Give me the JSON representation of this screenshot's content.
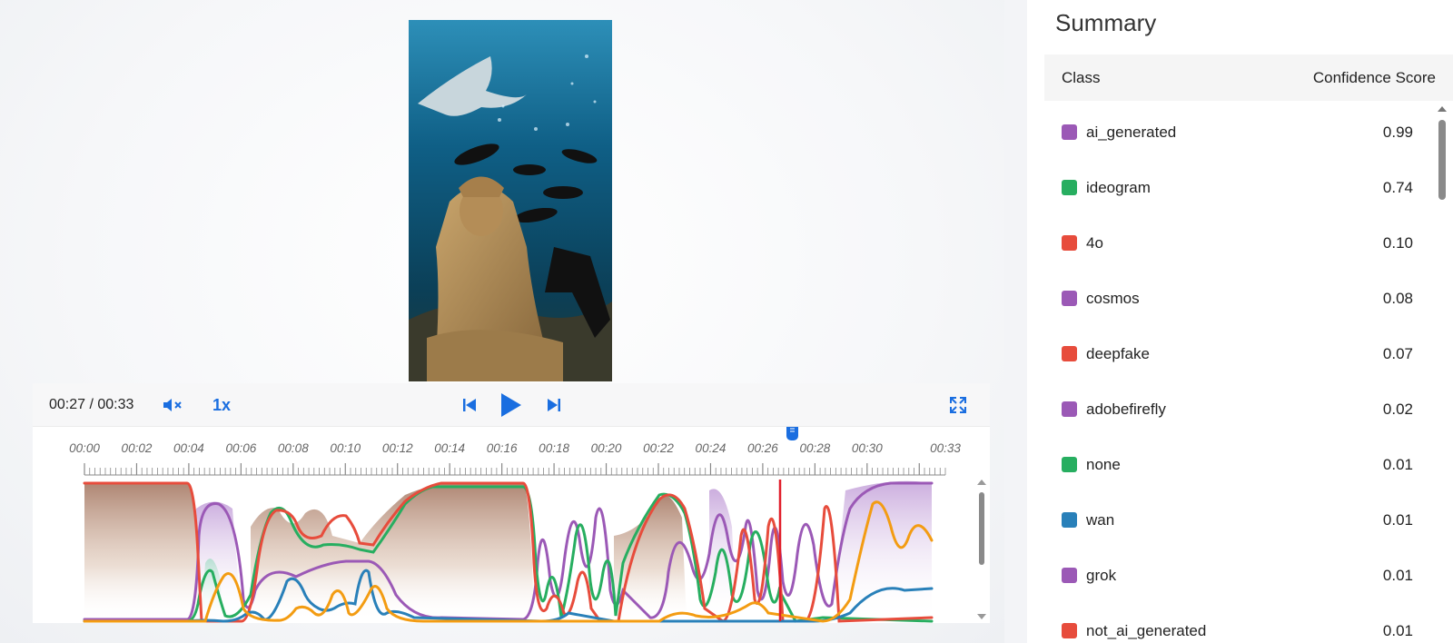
{
  "player": {
    "time": "00:27 / 00:33",
    "speed": "1x",
    "current_seconds": 27,
    "duration_seconds": 33,
    "icons": {
      "mute": "mute-icon",
      "prev": "skip-previous-icon",
      "play": "play-icon",
      "next": "skip-next-icon",
      "fullscreen": "fullscreen-icon"
    },
    "tick_labels": [
      "00:00",
      "00:02",
      "00:04",
      "00:06",
      "00:08",
      "00:10",
      "00:12",
      "00:14",
      "00:16",
      "00:18",
      "00:20",
      "00:22",
      "00:24",
      "00:26",
      "00:28",
      "00:30",
      "00:33"
    ],
    "colors": {
      "accent": "#1a6ee0",
      "playhead": "#e11d2a"
    }
  },
  "summary": {
    "title": "Summary",
    "col_class": "Class",
    "col_score": "Confidence Score",
    "rows": [
      {
        "name": "ai_generated",
        "score": "0.99",
        "color": "#9b59b6"
      },
      {
        "name": "ideogram",
        "score": "0.74",
        "color": "#27ae60"
      },
      {
        "name": "4o",
        "score": "0.10",
        "color": "#e74c3c"
      },
      {
        "name": "cosmos",
        "score": "0.08",
        "color": "#9b59b6"
      },
      {
        "name": "deepfake",
        "score": "0.07",
        "color": "#e74c3c"
      },
      {
        "name": "adobefirefly",
        "score": "0.02",
        "color": "#9b59b6"
      },
      {
        "name": "none",
        "score": "0.01",
        "color": "#27ae60"
      },
      {
        "name": "wan",
        "score": "0.01",
        "color": "#2980b9"
      },
      {
        "name": "grok",
        "score": "0.01",
        "color": "#9b59b6"
      },
      {
        "name": "not_ai_generated",
        "score": "0.01",
        "color": "#e74c3c"
      }
    ]
  }
}
